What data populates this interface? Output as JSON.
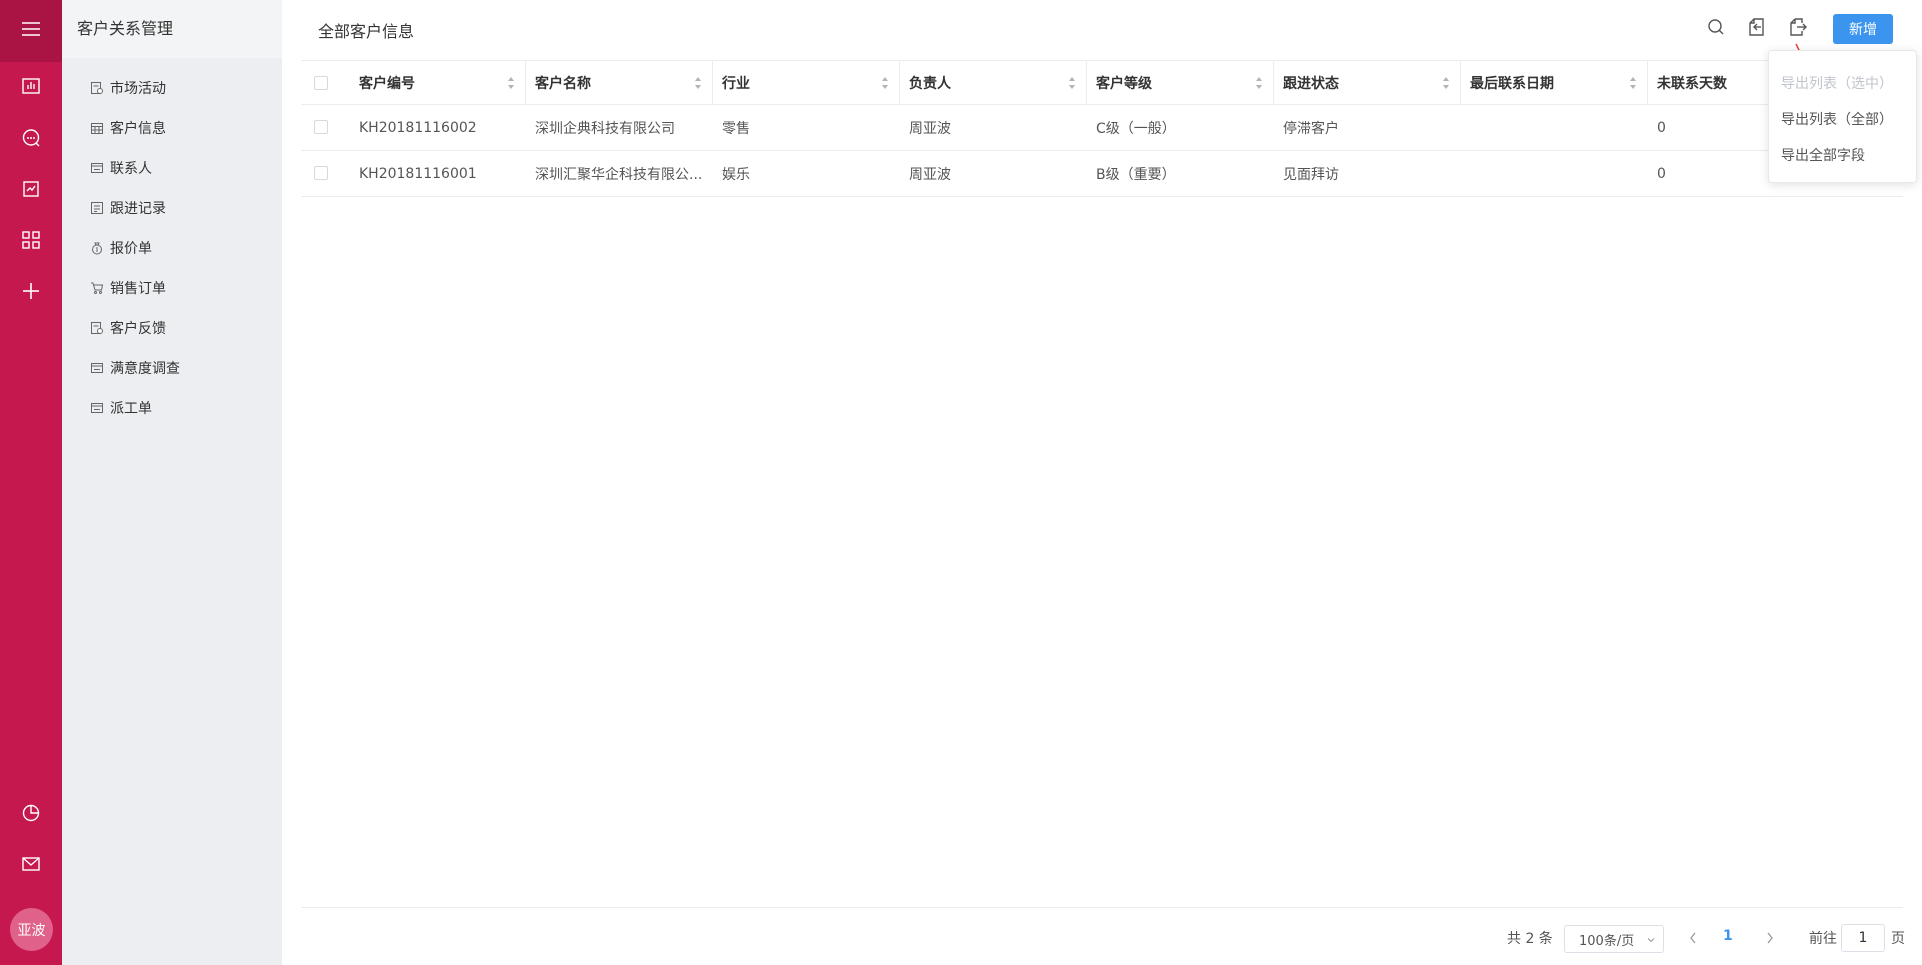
{
  "sidebar": {
    "title": "客户关系管理",
    "items": [
      {
        "label": "市场活动",
        "icon": "activity-doc-icon"
      },
      {
        "label": "客户信息",
        "icon": "calendar-grid-icon"
      },
      {
        "label": "联系人",
        "icon": "contact-card-icon"
      },
      {
        "label": "跟进记录",
        "icon": "record-list-icon"
      },
      {
        "label": "报价单",
        "icon": "money-bag-icon"
      },
      {
        "label": "销售订单",
        "icon": "cart-icon"
      },
      {
        "label": "客户反馈",
        "icon": "feedback-doc-icon"
      },
      {
        "label": "满意度调查",
        "icon": "survey-icon"
      },
      {
        "label": "派工单",
        "icon": "dispatch-icon"
      }
    ]
  },
  "rail": {
    "avatar_text": "亚波",
    "icons": [
      "menu-icon",
      "bar-chart-icon",
      "chat-icon",
      "report-icon",
      "apps-grid-icon",
      "plus-icon",
      "pie-chart-icon",
      "mail-icon"
    ]
  },
  "header": {
    "title": "全部客户信息",
    "new_button": "新增",
    "icons": [
      "search-icon",
      "import-icon",
      "export-icon"
    ]
  },
  "table": {
    "columns": [
      "客户编号",
      "客户名称",
      "行业",
      "负责人",
      "客户等级",
      "跟进状态",
      "最后联系日期",
      "未联系天数"
    ],
    "rows": [
      [
        "KH20181116002",
        "深圳企典科技有限公司",
        "零售",
        "周亚波",
        "C级（一般）",
        "停滞客户",
        "",
        "0"
      ],
      [
        "KH20181116001",
        "深圳汇聚华企科技有限公...",
        "娱乐",
        "周亚波",
        "B级（重要）",
        "见面拜访",
        "",
        "0"
      ]
    ]
  },
  "dropdown": {
    "items": [
      {
        "label": "导出列表（选中）",
        "disabled": true
      },
      {
        "label": "导出列表（全部）",
        "disabled": false
      },
      {
        "label": "导出全部字段",
        "disabled": false
      }
    ]
  },
  "pagination": {
    "total": "共 2 条",
    "page_size": "100条/页",
    "current_page": "1",
    "goto_label": "前往",
    "goto_value": "1",
    "page_unit": "页"
  },
  "colors": {
    "rail": "#c4184f",
    "rail_top": "#a91444",
    "primary": "#3b95ef",
    "pointer_arrow": "#e53935"
  }
}
